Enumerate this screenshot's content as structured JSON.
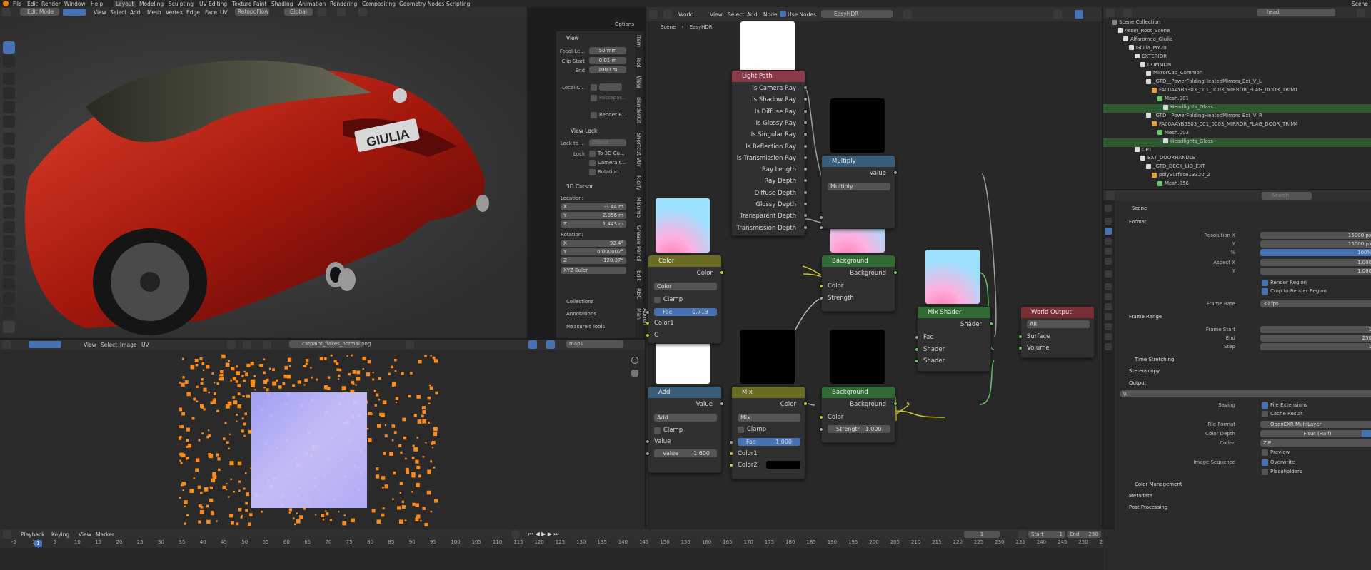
{
  "menubar": {
    "items": [
      "File",
      "Edit",
      "Render",
      "Window",
      "Help"
    ],
    "workspaces": [
      "Layout",
      "Modeling",
      "Sculpting",
      "UV Editing",
      "Texture Paint",
      "Shading",
      "Animation",
      "Rendering",
      "Compositing",
      "Geometry Nodes",
      "Scripting"
    ],
    "scene": "Scene"
  },
  "viewport": {
    "mode": "Edit Mode",
    "menus": [
      "View",
      "Select",
      "Add",
      "Mesh",
      "Vertex",
      "Edge",
      "Face",
      "UV"
    ],
    "retopo": "RetopoFlow",
    "orientation": "Global",
    "options": "Options"
  },
  "npanel": {
    "view_header": "View",
    "focal_label": "Focal Le...",
    "focal": "50 mm",
    "clip_start_label": "Clip Start",
    "clip_start": "0.01 m",
    "end_label": "End",
    "end": "1000 m",
    "local_camera": "Local C...",
    "passepartout": "Passepar...",
    "render_region": "Render R...",
    "view_lock": "View Lock",
    "lock_to": "Lock to ...",
    "object": "Object",
    "lock": "Lock",
    "to_3d_cursor": "To 3D Cu...",
    "camera_to": "Camera t...",
    "rotation": "Rotation",
    "cursor_header": "3D Cursor",
    "location": "Location:",
    "loc_x": "-3.44 m",
    "loc_y": "2.056 m",
    "loc_z": "1.443 m",
    "rotation_label": "Rotation:",
    "rot_x": "92.4°",
    "rot_y": "0.000002°",
    "rot_z": "-120.37°",
    "euler": "XYZ Euler",
    "collections": "Collections",
    "annotations": "Annotations",
    "measureit": "MeasureIt Tools",
    "x": "X",
    "y": "Y",
    "z": "Z",
    "tabs": [
      "Item",
      "Tool",
      "View",
      "BenderKit",
      "Shortcut VUr",
      "Rigify",
      "Misumo",
      "Grease Pencil",
      "Edit",
      "RBC",
      "Addon Man"
    ]
  },
  "uv_editor": {
    "menus": [
      "View",
      "Select",
      "Image",
      "UV"
    ],
    "image": "carpaint_flakes_normal.png",
    "map": "map1"
  },
  "node_editor": {
    "world": "World",
    "menus": [
      "View",
      "Select",
      "Add",
      "Node"
    ],
    "use_nodes": "Use Nodes",
    "world_name": "EasyHDR",
    "breadcrumb_scene": "Scene",
    "breadcrumb_world": "EasyHDR"
  },
  "nodes": {
    "light_path": {
      "title": "Light Path",
      "outputs": [
        "Is Camera Ray",
        "Is Shadow Ray",
        "Is Diffuse Ray",
        "Is Glossy Ray",
        "Is Singular Ray",
        "Is Reflection Ray",
        "Is Transmission Ray",
        "Ray Length",
        "Ray Depth",
        "Diffuse Depth",
        "Glossy Depth",
        "Transparent Depth",
        "Transmission Depth"
      ]
    },
    "multiply": {
      "title": "Multiply",
      "output": "Value",
      "op": "Multiply"
    },
    "color": {
      "title": "Color",
      "output": "Color",
      "mode": "Color",
      "clamp": "Clamp",
      "fac_label": "Fac",
      "fac": "0.713",
      "color1": "Color1",
      "color2": "C"
    },
    "background1": {
      "title": "Background",
      "output": "Background",
      "color": "Color",
      "strength": "Strength"
    },
    "mix_shader": {
      "title": "Mix Shader",
      "output": "Shader",
      "fac": "Fac",
      "shader1": "Shader",
      "shader2": "Shader"
    },
    "world_output": {
      "title": "World Output",
      "target": "All",
      "surface": "Surface",
      "volume": "Volume"
    },
    "add": {
      "title": "Add",
      "output": "Value",
      "op": "Add",
      "clamp": "Clamp",
      "value_in": "Value",
      "value_label": "Value",
      "value": "1.600"
    },
    "mix": {
      "title": "Mix",
      "output": "Color",
      "mode": "Mix",
      "clamp": "Clamp",
      "fac_label": "Fac",
      "fac": "1.000",
      "color1": "Color1",
      "color2": "Color2"
    },
    "background2": {
      "title": "Background",
      "output": "Background",
      "color": "Color",
      "strength_label": "Strength",
      "strength": "1.000"
    }
  },
  "outliner": {
    "search": "head",
    "rows": [
      "Scene Collection",
      "Asset_Root_Scene",
      "Alfaromeo_Giulia",
      "Giulia_MY20",
      "EXTERIOR",
      "COMMON",
      "MirrorCap_Common",
      "_GTD__PowerFoldingHeatedMirrors_Ext_V_L",
      "FA00AAYB5303_001_0003_MIRROR_FLAG_DOOR_TRIM1",
      "Mesh.001",
      "Headlights_Glass",
      "_GTD__PowerFoldingHeatedMirrors_Ext_V_R",
      "FA00AAYB5303_001_0003_MIRROR_FLAG_DOOR_TRIM4",
      "Mesh.003",
      "Headlights_Glass",
      "OPT",
      "EXT_DOORHANDLE",
      "_GTD_DECK_LID_EXT",
      "polySurface13320_2",
      "Mesh.856"
    ]
  },
  "properties": {
    "scene": "Scene",
    "format": "Format",
    "resolution_x_label": "Resolution X",
    "resolution_x": "15000 px",
    "y_label": "Y",
    "resolution_y": "15000 px",
    "pct_label": "%",
    "pct": "100%",
    "aspect_x_label": "Aspect X",
    "aspect_x": "1.000",
    "aspect_y": "1.000",
    "render_region": "Render Region",
    "crop": "Crop to Render Region",
    "frame_rate_label": "Frame Rate",
    "frame_rate": "30 fps",
    "frame_range": "Frame Range",
    "frame_start_label": "Frame Start",
    "frame_start": "1",
    "end_label": "End",
    "end": "250",
    "step_label": "Step",
    "step": "1",
    "time_stretching": "Time Stretching",
    "stereoscopy": "Stereoscopy",
    "output": "Output",
    "path": "\\\\",
    "saving": "Saving",
    "file_ext": "File Extensions",
    "cache": "Cache Result",
    "file_format_label": "File Format",
    "file_format": "OpenEXR MultiLayer",
    "color_depth_label": "Color Depth",
    "color_depth": "Float (Half)",
    "codec_label": "Codec",
    "codec": "ZIP",
    "preview": "Preview",
    "image_sequence": "Image Sequence",
    "overwrite": "Overwrite",
    "placeholders": "Placeholders",
    "color_mgmt": "Color Management",
    "metadata": "Metadata",
    "post": "Post Processing",
    "search": "Search"
  },
  "timeline": {
    "menus": [
      "Playback",
      "Keying",
      "View",
      "Marker"
    ],
    "current": "1",
    "start_label": "Start",
    "start": "1",
    "end_label": "End",
    "end": "250",
    "ticks": [
      "-5",
      "1",
      "5",
      "10",
      "15",
      "20",
      "25",
      "30",
      "35",
      "40",
      "45",
      "50",
      "55",
      "60",
      "65",
      "70",
      "75",
      "80",
      "85",
      "90",
      "95",
      "100",
      "105",
      "110",
      "115",
      "120",
      "125",
      "130",
      "135",
      "140",
      "145",
      "150",
      "155",
      "160",
      "165",
      "170",
      "175",
      "180",
      "185",
      "190",
      "195",
      "200",
      "205",
      "210",
      "215",
      "220",
      "225",
      "230",
      "235",
      "240",
      "245",
      "250",
      "255"
    ]
  },
  "colors": {
    "node_input": "#8a3a4b",
    "node_converter": "#3a5d7a",
    "node_shader": "#2f6a32",
    "node_output": "#7a2f35",
    "node_color": "#6b6b24",
    "accent": "#4772b3",
    "socket_yellow": "#c7c729",
    "socket_green": "#63c763",
    "socket_gray": "#a1a1a1",
    "socket_purple": "#6363c7"
  }
}
